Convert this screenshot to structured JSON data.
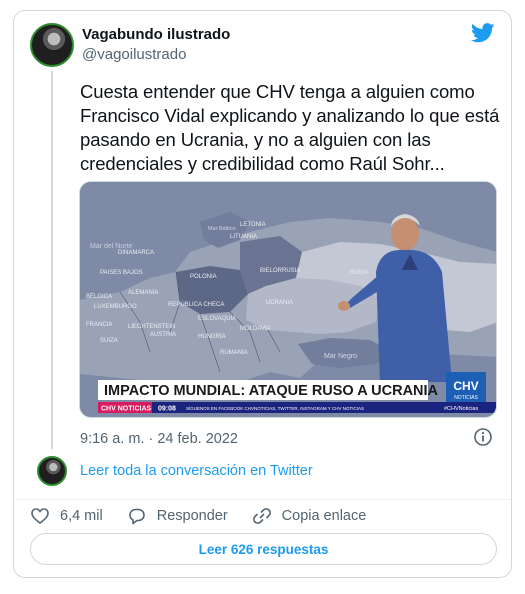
{
  "author": {
    "display_name": "Vagabundo ilustrado",
    "handle": "@vagoilustrado"
  },
  "tweet": {
    "text": "Cuesta entender que CHV tenga a alguien como Francisco Vidal explicando y analizando lo que está pasando en Ucrania, y no a alguien con las credenciales y credibilidad como Raúl Sohr...",
    "timestamp": "9:16 a. m. · 24 feb. 2022"
  },
  "media": {
    "map_labels": {
      "mar_del_norte": "Mar del Norte",
      "dinamarca": "DINAMARCA",
      "paises_bajos": "PAISES BAJOS",
      "alemania": "ALEMANIA",
      "belgica": "BÉLGICA",
      "luxemburgo": "LUXEMBURGO",
      "francia": "FRANCIA",
      "suiza": "SUIZA",
      "austria": "AUSTRIA",
      "polonia": "POLONIA",
      "bielorrusia": "BIELORRUSIA",
      "lituania": "LITUANIA",
      "letonia": "LETONIA",
      "rusia": "RUSIA",
      "ucrania": "UCRANIA",
      "moldavia": "MOLDAVIA",
      "rumania": "RUMANIA",
      "hungria": "HUNGRÍA",
      "eslovaquia": "ESLOVAQUIA",
      "republica_checa": "REPÚBLICA CHECA",
      "liechtenstein": "LIECHTENSTEIN",
      "mar_negro": "Mar Negro",
      "mar_baltico": "Mar Báltico"
    },
    "banner_headline": "IMPACTO MUNDIAL: ATAQUE RUSO A UCRANIA",
    "channel_logo": "CHV",
    "channel_logo_sub": "NOTICIAS",
    "ticker_brand": "CHV NOTICIAS",
    "ticker_time": "09:08",
    "ticker_follow": "SÍGUENOS EN FACEBOOK CHVNOTICIAS, TWITTER, INSTAGRAM Y CHV NOTICIAS",
    "ticker_hashtag": "#CHVNoticias",
    "colors": {
      "banner_bg": "#ffffff",
      "banner_text": "#1a1a1a",
      "logo_bg": "#1d5fb4",
      "ticker_brand_bg": "#d81b60",
      "ticker_bg": "#1a237e"
    }
  },
  "links": {
    "read_thread": "Leer toda la conversación en Twitter"
  },
  "actions": {
    "like_count": "6,4 mil",
    "reply_label": "Responder",
    "copy_link_label": "Copia enlace"
  },
  "replies_button": "Leer 626 respuestas",
  "icons": {
    "logo": "twitter-bird-icon",
    "info": "info-icon",
    "like": "heart-icon",
    "reply": "speech-bubble-icon",
    "copy": "link-icon"
  },
  "colors": {
    "accent": "#1d9bf0",
    "secondary_text": "#536471",
    "border": "#cfd9de",
    "avatar_ring": "#2e8b2e"
  }
}
